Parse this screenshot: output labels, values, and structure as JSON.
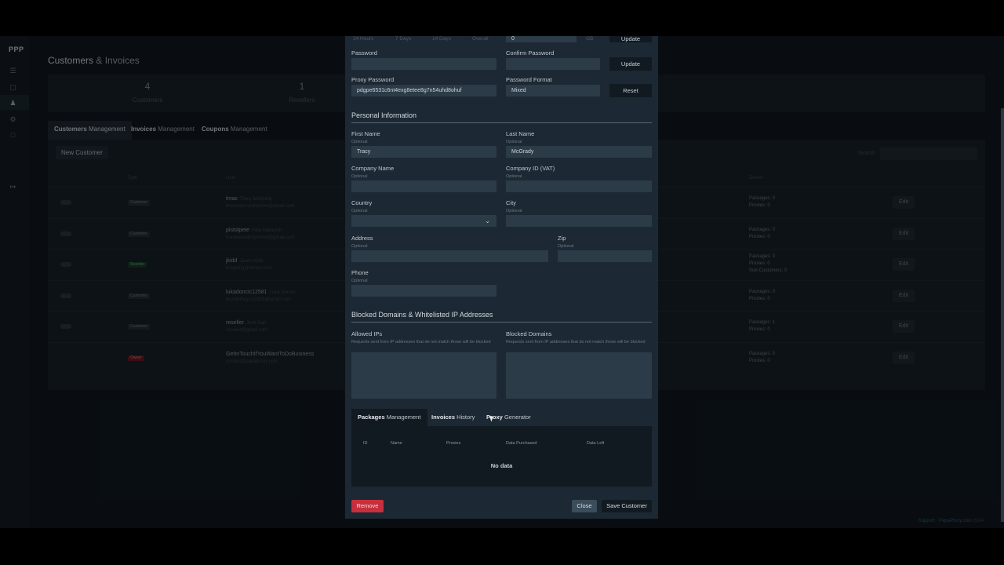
{
  "app": {
    "brand": "PPP"
  },
  "page": {
    "title_a": "Customers",
    "title_amp": "&",
    "title_b": "Invoices"
  },
  "stats": [
    {
      "value": "4",
      "label": "Customers"
    },
    {
      "value": "1",
      "label": "Resellers"
    }
  ],
  "tabs": [
    {
      "bold": "Customers",
      "rest": " Management"
    },
    {
      "bold": "Invoices",
      "rest": " Management"
    },
    {
      "bold": "Coupons",
      "rest": " Management"
    }
  ],
  "table": {
    "new_button": "New Customer",
    "search_label": "Search",
    "headers": {
      "type": "Type",
      "user": "User",
      "details": "Details"
    },
    "edit_label": "Edit",
    "details_labels": {
      "packages": "Packages: ",
      "proxies": "Proxies: ",
      "subs": "Sub-Customers: "
    },
    "rows": [
      {
        "type": "Customer",
        "username": "tmac",
        "fullname": "Tracy McGrady",
        "email": "tmacman.contactme@gmail.com",
        "packages": "0",
        "proxies": "0"
      },
      {
        "type": "Customer",
        "username": "pistolpete",
        "fullname": "Pete Maravich",
        "email": "thenewandimproved@gmail.com",
        "packages": "0",
        "proxies": "0"
      },
      {
        "type": "Reseller",
        "username": "jkidd",
        "fullname": "Jason Kidd",
        "email": "dropping@dimes.com",
        "packages": "0",
        "proxies": "0",
        "subs": "0"
      },
      {
        "type": "Customer",
        "username": "lukadoncic12581",
        "fullname": "Luka Doncic",
        "email": "wonderboy102819@gmail.com",
        "packages": "0",
        "proxies": "0"
      },
      {
        "type": "Customer",
        "username": "reseller",
        "fullname": "Josh Hart",
        "email": "reseller@gmail.com",
        "packages": "1",
        "proxies": "0"
      },
      {
        "type": "Owner",
        "username": "GetInTouchIfYouWantToDoBusiness",
        "fullname": "",
        "email": "contact@papaproxy.com",
        "packages": "0",
        "proxies": "0"
      }
    ]
  },
  "footer": {
    "support": "Support",
    "brand": "PapaProxy.com",
    "year": "2024"
  },
  "modal": {
    "top_row": {
      "h24": "24 Hours",
      "d7": "7 Days",
      "d14": "14 Days",
      "overall": "Overall",
      "value": "0",
      "unit": "GB",
      "update": "Update"
    },
    "password": {
      "label": "Password",
      "value": ""
    },
    "confirm_password": {
      "label": "Confirm Password",
      "value": ""
    },
    "update_button": "Update",
    "proxy_password": {
      "label": "Proxy Password",
      "value": "pdgpe6531c6nt4exg8etee8g7n54uhd8ohuf"
    },
    "password_format": {
      "label": "Password Format",
      "value": "Mixed"
    },
    "reset_button": "Reset",
    "personal_title": "Personal Information",
    "optional": "Optional",
    "first_name": {
      "label": "First Name",
      "value": "Tracy"
    },
    "last_name": {
      "label": "Last Name",
      "value": "McGrady"
    },
    "company_name": {
      "label": "Company Name",
      "value": ""
    },
    "company_id": {
      "label": "Company ID (VAT)",
      "value": ""
    },
    "country": {
      "label": "Country",
      "value": ""
    },
    "city": {
      "label": "City",
      "value": ""
    },
    "address": {
      "label": "Address",
      "value": ""
    },
    "zip": {
      "label": "Zip",
      "value": ""
    },
    "phone": {
      "label": "Phone",
      "value": ""
    },
    "blocked_title": "Blocked Domains & Whitelisted IP Addresses",
    "allowed_ips": {
      "label": "Allowed IPs",
      "desc": "Requests sent from IP addresses that do not match those will be blocked"
    },
    "blocked_domains": {
      "label": "Blocked Domains",
      "desc": "Requests sent from IP addresses that do not match those will be blocked"
    },
    "ptabs": [
      {
        "bold": "Packages",
        "rest": " Management"
      },
      {
        "bold": "Invoices",
        "rest": " History"
      },
      {
        "bold": "Proxy",
        "rest": " Generator"
      }
    ],
    "ptable": {
      "id": "ID",
      "name": "Name",
      "proxies": "Proxies",
      "purchased": "Data Purchased",
      "left": "Data Left",
      "empty": "No data"
    },
    "remove_button": "Remove",
    "close_button": "Close",
    "save_button": "Save Customer"
  }
}
